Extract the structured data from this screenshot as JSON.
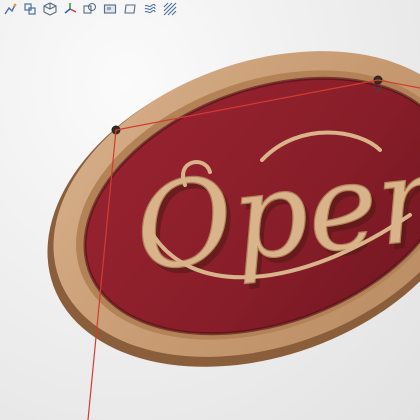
{
  "toolbar": {
    "tools": [
      {
        "name": "sketch-tool-icon"
      },
      {
        "name": "transform-tool-icon"
      },
      {
        "name": "view-cube-icon"
      },
      {
        "name": "axis-gizmo-icon"
      },
      {
        "name": "boolean-tool-icon"
      },
      {
        "name": "material-tool-icon"
      },
      {
        "name": "plane-tool-icon"
      },
      {
        "name": "texture-tool-icon"
      },
      {
        "name": "hatch-tool-icon"
      }
    ]
  },
  "model": {
    "sign_text": "Open",
    "colors": {
      "wood": "#c79a72",
      "wood_dark": "#a87650",
      "panel": "#8c1f2a",
      "panel_dark": "#6a141d",
      "cable": "#d23c30"
    }
  }
}
